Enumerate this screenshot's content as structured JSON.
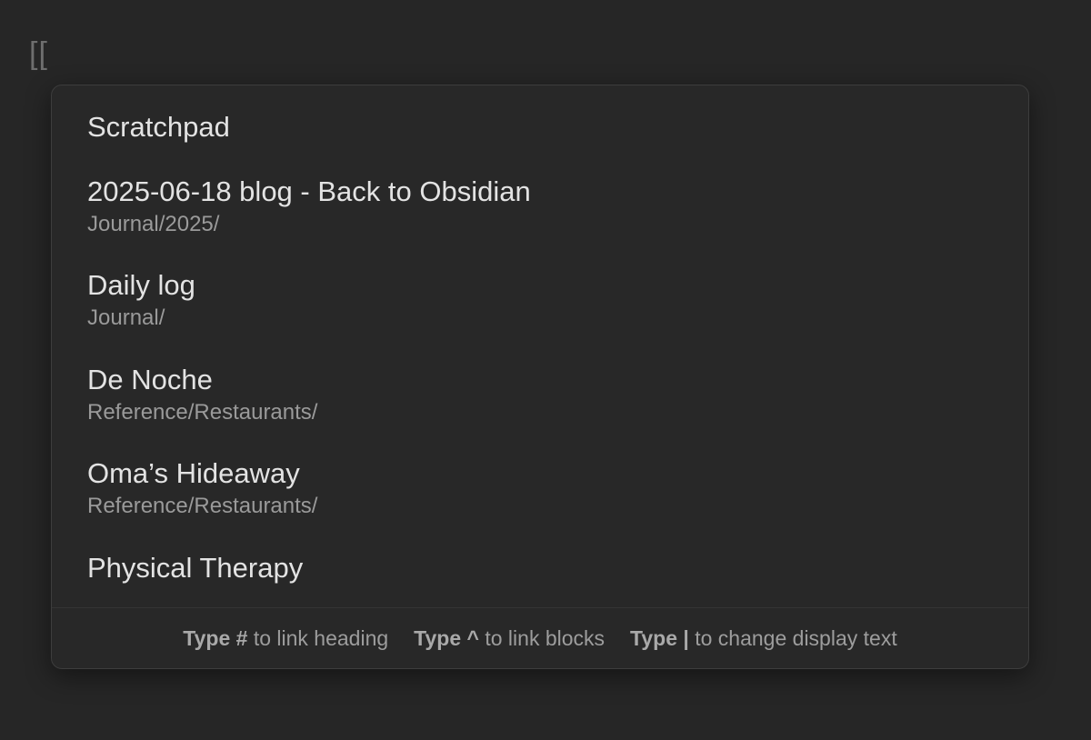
{
  "editor": {
    "text": "[["
  },
  "suggestions": [
    {
      "title": "Scratchpad",
      "path": ""
    },
    {
      "title": "2025-06-18 blog - Back to Obsidian",
      "path": "Journal/2025/"
    },
    {
      "title": "Daily log",
      "path": "Journal/"
    },
    {
      "title": "De Noche",
      "path": "Reference/Restaurants/"
    },
    {
      "title": "Oma’s Hideaway",
      "path": "Reference/Restaurants/"
    },
    {
      "title": "Physical Therapy",
      "path": ""
    }
  ],
  "footer": {
    "hints": [
      {
        "key": "Type #",
        "text": "to link heading"
      },
      {
        "key": "Type ^",
        "text": "to link blocks"
      },
      {
        "key": "Type |",
        "text": "to change display text"
      }
    ]
  }
}
